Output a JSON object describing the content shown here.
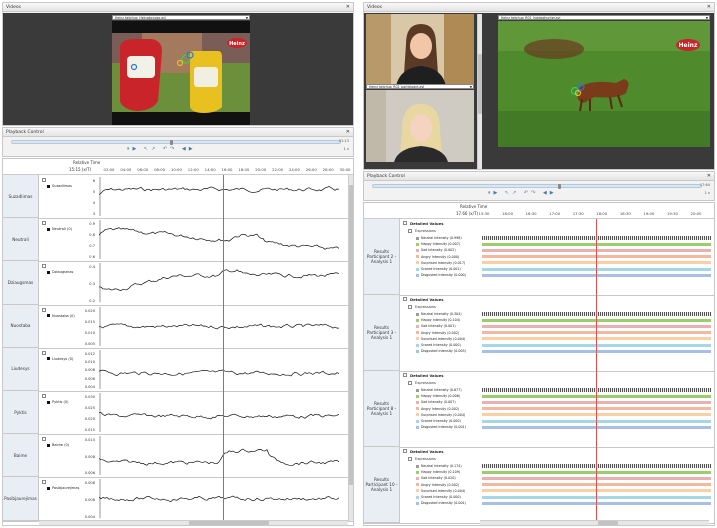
{
  "left": {
    "videos_title": "Videos",
    "video_file": "Heinz ketchup_Heinzdoyuga.avi",
    "playback_title": "Playback Control",
    "time_end": "01:13",
    "speed": "1 x",
    "relative_time_label": "Relative Time",
    "current_time": "15:15 (x/T)",
    "ticks": [
      "02:00",
      "04:00",
      "06:00",
      "08:00",
      "10:00",
      "12:00",
      "14:00",
      "16:00",
      "18:00",
      "20:00",
      "22:00",
      "24:00",
      "26:00",
      "28:00",
      "30:00"
    ],
    "rows": [
      {
        "label": "Suzadlimas",
        "legend": "Suzadlimas",
        "y": [
          "6",
          "5",
          "4",
          "3"
        ]
      },
      {
        "label": "Neutrali",
        "legend": "Neutrali (0)",
        "y": [
          "0.9",
          "0.8",
          "0.7",
          "0.6"
        ]
      },
      {
        "label": "Dziaugsmas",
        "legend": "Dziaugsmas",
        "y": [
          "0.4",
          "0.3",
          "0.2"
        ]
      },
      {
        "label": "Nuostaba",
        "legend": "Nuostaba (0)",
        "y": [
          "0.020",
          "0.015",
          "0.010",
          "0.005"
        ]
      },
      {
        "label": "Liudesys",
        "legend": "Liudesys (0)",
        "y": [
          "0.012",
          "0.010",
          "0.008",
          "0.006",
          "0.004"
        ]
      },
      {
        "label": "Pyktis",
        "legend": "Pyktis (0)",
        "y": [
          "0.030",
          "0.025",
          "0.020",
          "0.015"
        ]
      },
      {
        "label": "Baime",
        "legend": "Baime (0)",
        "y": [
          "0.010",
          "0.008",
          "0.006"
        ]
      },
      {
        "label": "Pasibjaurejimas",
        "legend": "Pasibjaurejimas",
        "y": [
          "0.008",
          "0.006",
          "0.004"
        ]
      }
    ]
  },
  "right": {
    "videos_title": "Videos",
    "video_file_1": "Heinz ketchup_R02_participant.avi",
    "video_file_2": "Heinz ketchup_R04_participant.avi",
    "video_file_main": "Heinz ketchup_R01_hotdoghunter.avi",
    "logo_text": "Heinz",
    "playback_title": "Playback Control",
    "time_end": "17:64",
    "speed": "1 x",
    "relative_time_label": "Relative Time",
    "current_time": "17.66 (x/T)",
    "ticks": [
      "15:30",
      "16:00",
      "16:30",
      "17:00",
      "17:30",
      "18:00",
      "18:30",
      "19:00",
      "19:30",
      "20:00"
    ],
    "groups": [
      {
        "label": "Results Participant 2 - Analysis 1",
        "detailed": "Detailed Values",
        "expr": "Expressions",
        "items": [
          "Neutral Intensity (0.998)",
          "Happy Intensity (0.007)",
          "Sad Intensity (0.002)",
          "Angry Intensity (0.000)",
          "Surprised Intensity (0.017)",
          "Scared Intensity (0.001)",
          "Disgusted Intensity (0.000)"
        ]
      },
      {
        "label": "Results Participant 3 - Analysis 1",
        "detailed": "Detailed Values",
        "expr": "Expressions",
        "items": [
          "Neutral Intensity (0.304)",
          "Happy Intensity (0.104)",
          "Sad Intensity (0.001)",
          "Angry Intensity (0.002)",
          "Surprised Intensity (0.004)",
          "Scared Intensity (0.000)",
          "Disgusted Intensity (0.003)"
        ]
      },
      {
        "label": "Results Participant 8 - Analysis 1",
        "detailed": "Detailed Values",
        "expr": "Expressions",
        "items": [
          "Neutral Intensity (0.677)",
          "Happy Intensity (0.006)",
          "Sad Intensity (0.007)",
          "Angry Intensity (0.002)",
          "Surprised Intensity (0.004)",
          "Scared Intensity (0.000)",
          "Disgusted Intensity (0.001)"
        ]
      },
      {
        "label": "Results Participant 10 - Analysis 1",
        "detailed": "Detailed Values",
        "expr": "Expressions",
        "items": [
          "Neutral Intensity (0.174)",
          "Happy Intensity (0.109)",
          "Sad Intensity (0.020)",
          "Angry Intensity (0.002)",
          "Surprised Intensity (0.004)",
          "Scared Intensity (0.000)",
          "Disgusted Intensity (0.001)"
        ]
      }
    ],
    "colors": [
      "#9a9a9a",
      "#9acd6b",
      "#e8b2b2",
      "#f3b9a0",
      "#f9cfa6",
      "#a7d7e7",
      "#a6bfe3"
    ]
  }
}
